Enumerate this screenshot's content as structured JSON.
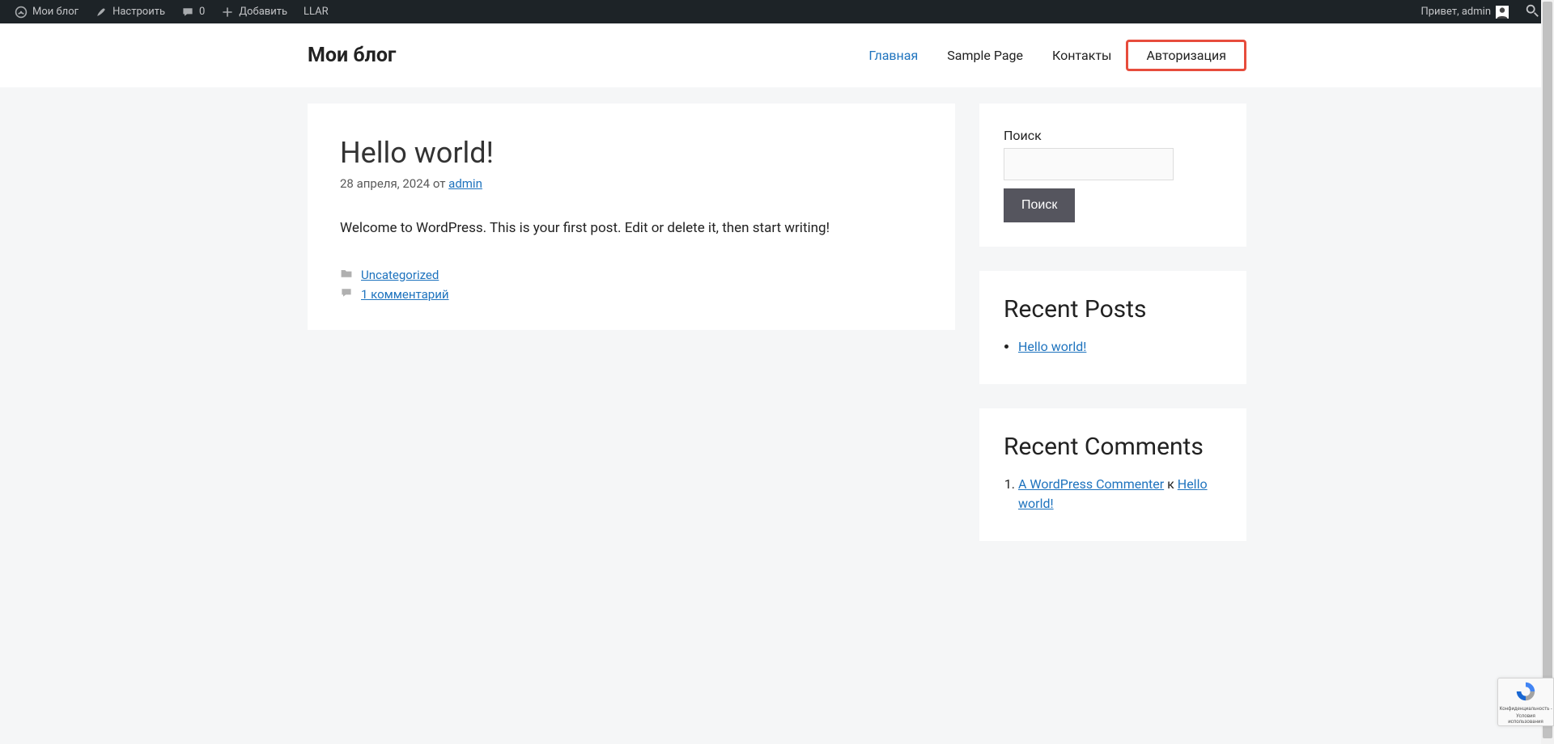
{
  "adminbar": {
    "site_name": "Мои блог",
    "customize": "Настроить",
    "comments_count": "0",
    "add_new": "Добавить",
    "llar": "LLAR",
    "greeting": "Привет, admin"
  },
  "header": {
    "site_title": "Мои блог",
    "nav": [
      {
        "label": "Главная",
        "active": true,
        "highlight": false
      },
      {
        "label": "Sample Page",
        "active": false,
        "highlight": false
      },
      {
        "label": "Контакты",
        "active": false,
        "highlight": false
      },
      {
        "label": "Авторизация",
        "active": false,
        "highlight": true
      }
    ]
  },
  "post": {
    "title": "Hello world!",
    "date": "28 апреля, 2024",
    "by_label": "от",
    "author": "admin",
    "body": "Welcome to WordPress. This is your first post. Edit or delete it, then start writing!",
    "category": "Uncategorized",
    "comments_link": "1 комментарий"
  },
  "sidebar": {
    "search": {
      "label": "Поиск",
      "button": "Поиск"
    },
    "recent_posts": {
      "title": "Recent Posts",
      "items": [
        "Hello world!"
      ]
    },
    "recent_comments": {
      "title": "Recent Comments",
      "commenter": "A WordPress Commenter",
      "connector": "к",
      "post": "Hello world!"
    }
  },
  "recaptcha": {
    "line1": "Конфиденциальность -",
    "line2": "Условия использования"
  }
}
